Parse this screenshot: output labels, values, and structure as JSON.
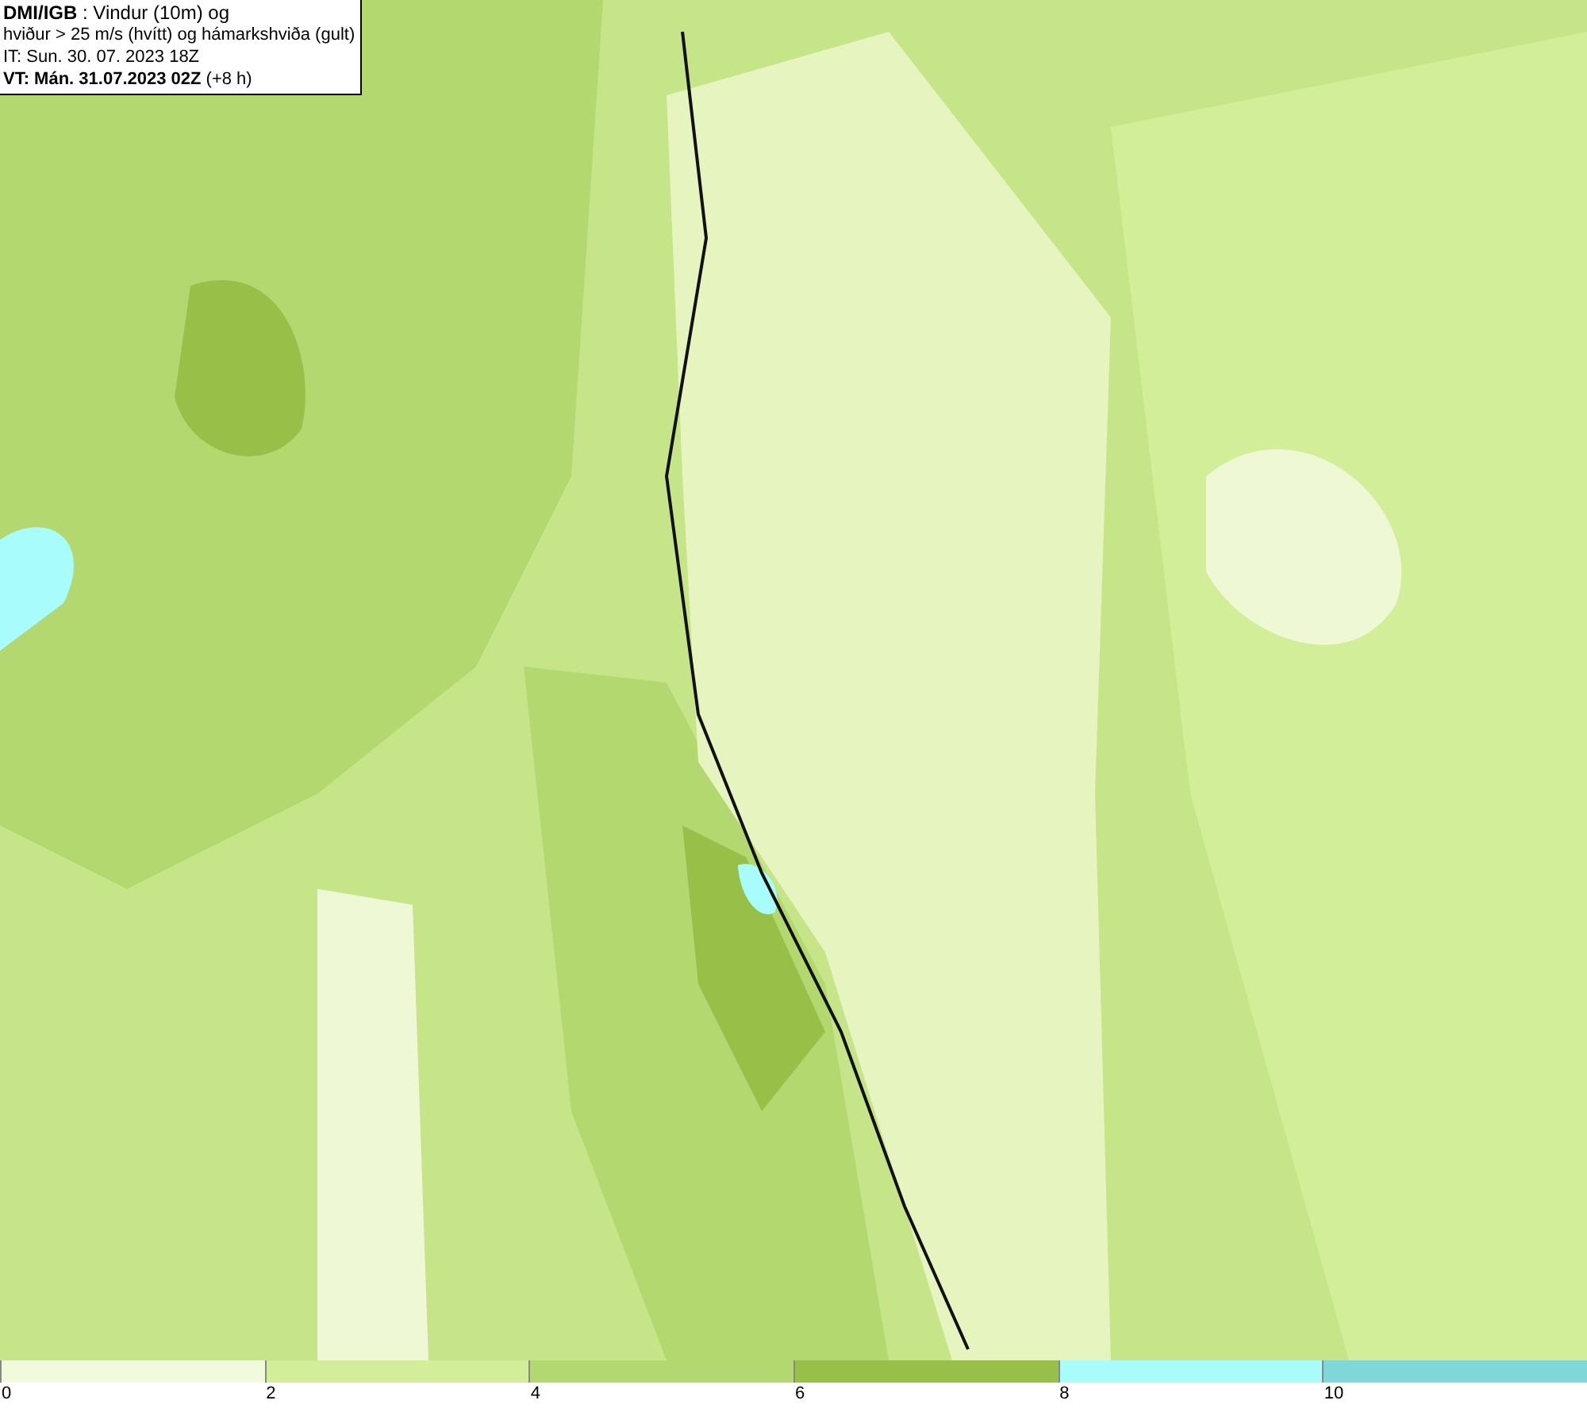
{
  "header": {
    "lines": [
      "**DMI/IGB** : Vindur (10m) og",
      "hviður > 25 m/s (hvítt) og hámarkshviða (gult)",
      "IT: Sun. 30. 07. 2023 18Z",
      "**VT: Mán. 31.07.2023 02Z** (+8 h)"
    ]
  },
  "legend": {
    "bins": [
      {
        "label": "0",
        "color": "#f2fadc"
      },
      {
        "label": "2",
        "color": "#d3ee98"
      },
      {
        "label": "4",
        "color": "#b3d870"
      },
      {
        "label": "6",
        "color": "#98c048"
      },
      {
        "label": "8",
        "color": "#a8fcfc"
      },
      {
        "label": "10",
        "color": "#7ed8da"
      }
    ]
  }
}
